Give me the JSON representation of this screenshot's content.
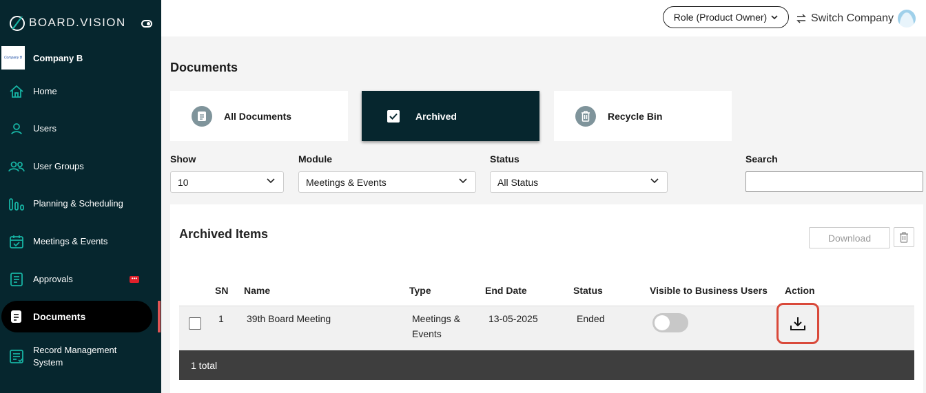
{
  "brand": {
    "name": "BOARD.VISION"
  },
  "company": {
    "name": "Company B",
    "logo_text": "Company B"
  },
  "sidebar": {
    "items": [
      {
        "label": "Home",
        "icon": "home-icon"
      },
      {
        "label": "Users",
        "icon": "user-icon"
      },
      {
        "label": "User Groups",
        "icon": "user-group-icon"
      },
      {
        "label": "Planning & Scheduling",
        "icon": "chart-bars-icon"
      },
      {
        "label": "Meetings & Events",
        "icon": "calendar-check-icon"
      },
      {
        "label": "Approvals",
        "icon": "approval-doc-icon",
        "badge_icon": "chat-badge-icon"
      },
      {
        "label": "Documents",
        "icon": "documents-icon",
        "active": true
      },
      {
        "label": "Record Management System",
        "icon": "record-management-icon"
      }
    ]
  },
  "topbar": {
    "role_label": "Role (Product Owner)",
    "switch_label": "Switch Company"
  },
  "page": {
    "title": "Documents"
  },
  "tabs": [
    {
      "label": "All Documents",
      "icon": "document-icon"
    },
    {
      "label": "Archived",
      "icon": "archive-check-icon",
      "active": true
    },
    {
      "label": "Recycle Bin",
      "icon": "trash-icon"
    }
  ],
  "filters": {
    "show_label": "Show",
    "show_value": "10",
    "module_label": "Module",
    "module_value": "Meetings & Events",
    "status_label": "Status",
    "status_value": "All Status",
    "search_label": "Search",
    "search_value": ""
  },
  "panel": {
    "title": "Archived Items",
    "download_label": "Download",
    "columns": [
      "SN",
      "Name",
      "Type",
      "End Date",
      "Status",
      "Visible to Business Users",
      "Action"
    ],
    "rows": [
      {
        "sn": "1",
        "name": "39th Board Meeting",
        "type": "Meetings & Events",
        "end_date": "13-05-2025",
        "status": "Ended",
        "visible": false
      }
    ],
    "total_label": "1 total"
  },
  "colors": {
    "sidebar_bg": "#06262e",
    "accent_teal": "#17b3a3",
    "action_highlight": "#d9493a",
    "footer_bg": "#3e3e3e"
  }
}
